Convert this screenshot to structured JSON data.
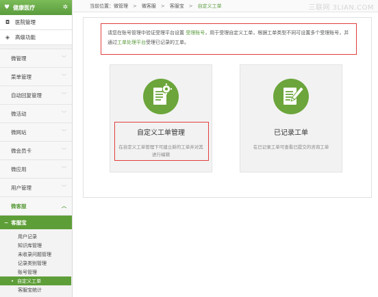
{
  "sidebar": {
    "brand": "健康医疗",
    "top_items": [
      {
        "label": "医院管理",
        "icon": "camera-icon"
      },
      {
        "label": "高级功能",
        "icon": "cube-icon"
      }
    ],
    "menus": [
      {
        "label": "微管理"
      },
      {
        "label": "菜单管理"
      },
      {
        "label": "自动回复管理"
      },
      {
        "label": "微活动"
      },
      {
        "label": "微网站"
      },
      {
        "label": "微会员卡"
      },
      {
        "label": "微应用"
      },
      {
        "label": "用户管理"
      },
      {
        "label": "微客服"
      }
    ],
    "submenu_head": "客服宝",
    "subitems": [
      {
        "label": "用户记录"
      },
      {
        "label": "知识库管理"
      },
      {
        "label": "未收录问题管理"
      },
      {
        "label": "记录类别管理"
      },
      {
        "label": "账号管理"
      },
      {
        "label": "自定义工单"
      },
      {
        "label": "客服宝统计"
      }
    ]
  },
  "breadcrumb": {
    "prefix": "当前位置：",
    "items": [
      "微管理",
      "微客服",
      "客服宝",
      "自定义工单"
    ],
    "separator": ">"
  },
  "watermark": "三联网 3LIAN.COM",
  "notice": {
    "part1": "请您在账号管理中验证受理平台设置",
    "link1": "受理账号",
    "part2": "，用于受理自定义工单，根据工单类型不同可设置多个受理账号，并通过",
    "link2": "工单处理平台",
    "part3": "受理已记录的工单。"
  },
  "cards": [
    {
      "title": "自定义工单管理",
      "desc": "在自定义工单管理下可建立新的工单并对其进行编辑",
      "icon": "document-gear-icon"
    },
    {
      "title": "已记录工单",
      "desc": "在已记录工单可查看已提交的咨询工单",
      "icon": "document-pencil-icon"
    }
  ],
  "colors": {
    "accent": "#5e9e38",
    "highlight": "#e23c3c"
  }
}
